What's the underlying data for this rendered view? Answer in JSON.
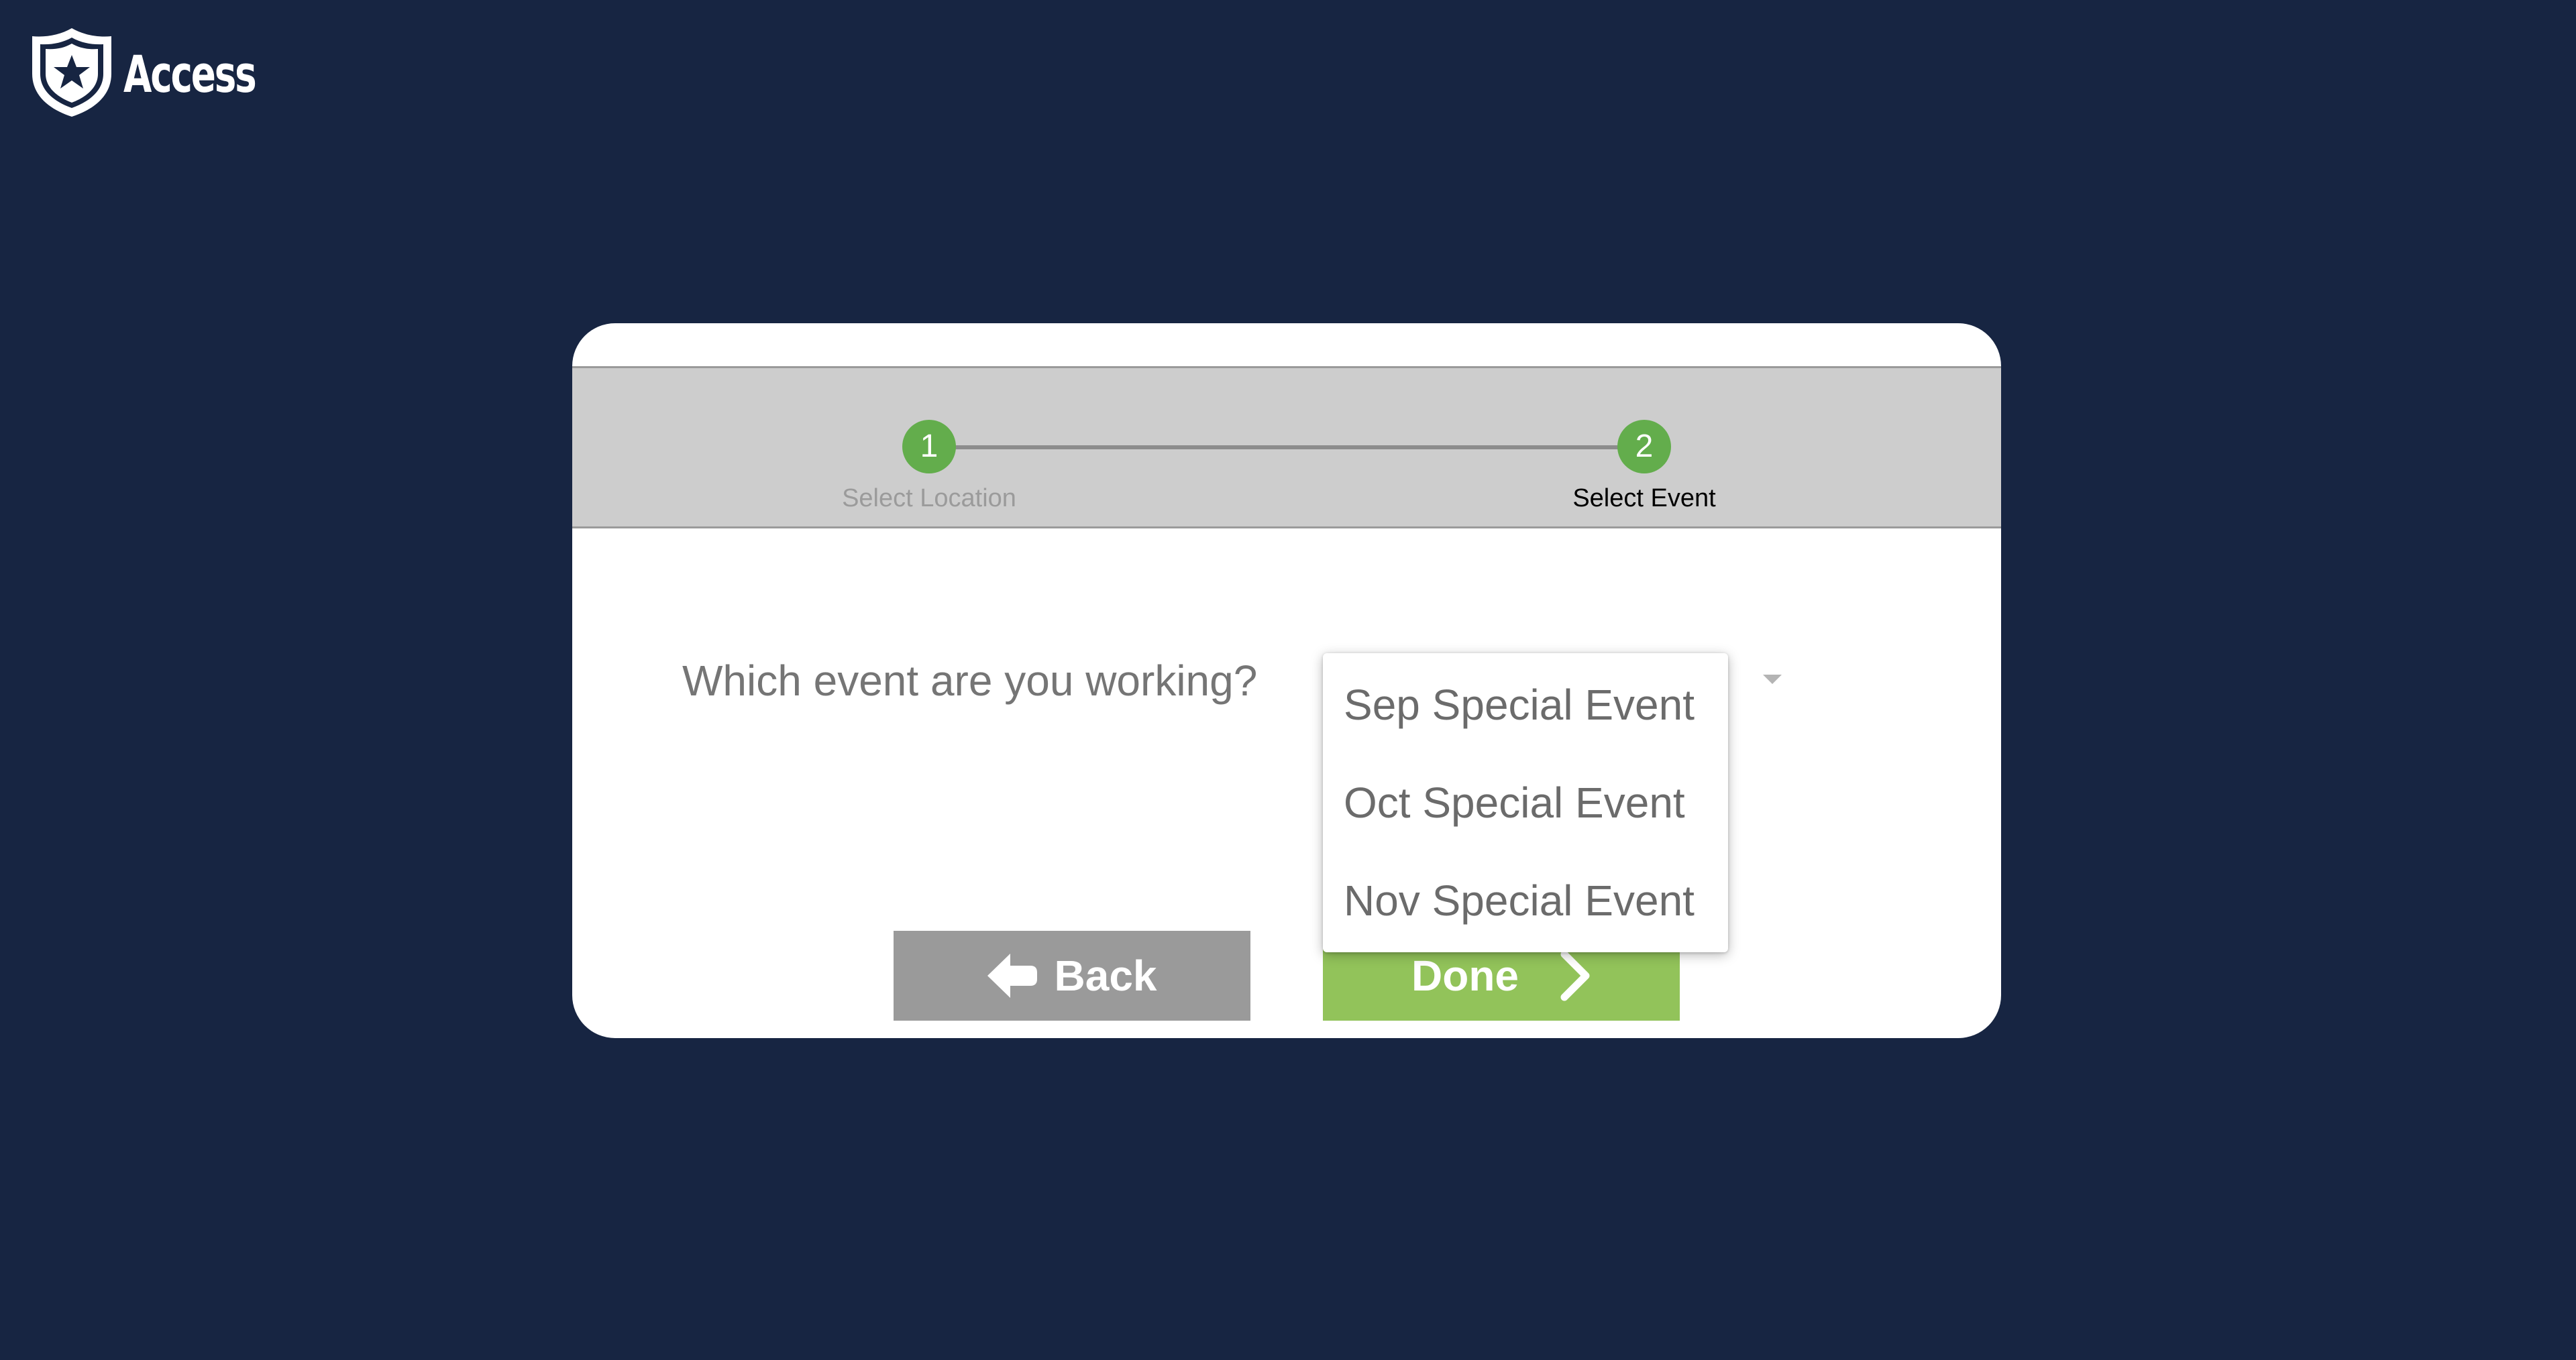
{
  "app": {
    "name": "Access"
  },
  "stepper": {
    "steps": [
      {
        "number": "1",
        "label": "Select Location",
        "state": "complete"
      },
      {
        "number": "2",
        "label": "Select Event",
        "state": "active"
      }
    ]
  },
  "form": {
    "question": "Which event are you working?"
  },
  "dropdown": {
    "options": [
      "Sep Special Event",
      "Oct Special Event",
      "Nov Special Event"
    ]
  },
  "buttons": {
    "back_label": "Back",
    "done_label": "Done"
  },
  "icons": {
    "logo": "shield-star-icon",
    "back": "arrow-left-icon",
    "done": "chevron-right-icon",
    "select": "caret-down-icon"
  },
  "colors": {
    "background": "#172542",
    "card": "#ffffff",
    "stepper_band": "#cdcdcd",
    "step_circle": "#63ad4c",
    "back_button": "#9a9a9a",
    "done_button": "#92c35a"
  }
}
